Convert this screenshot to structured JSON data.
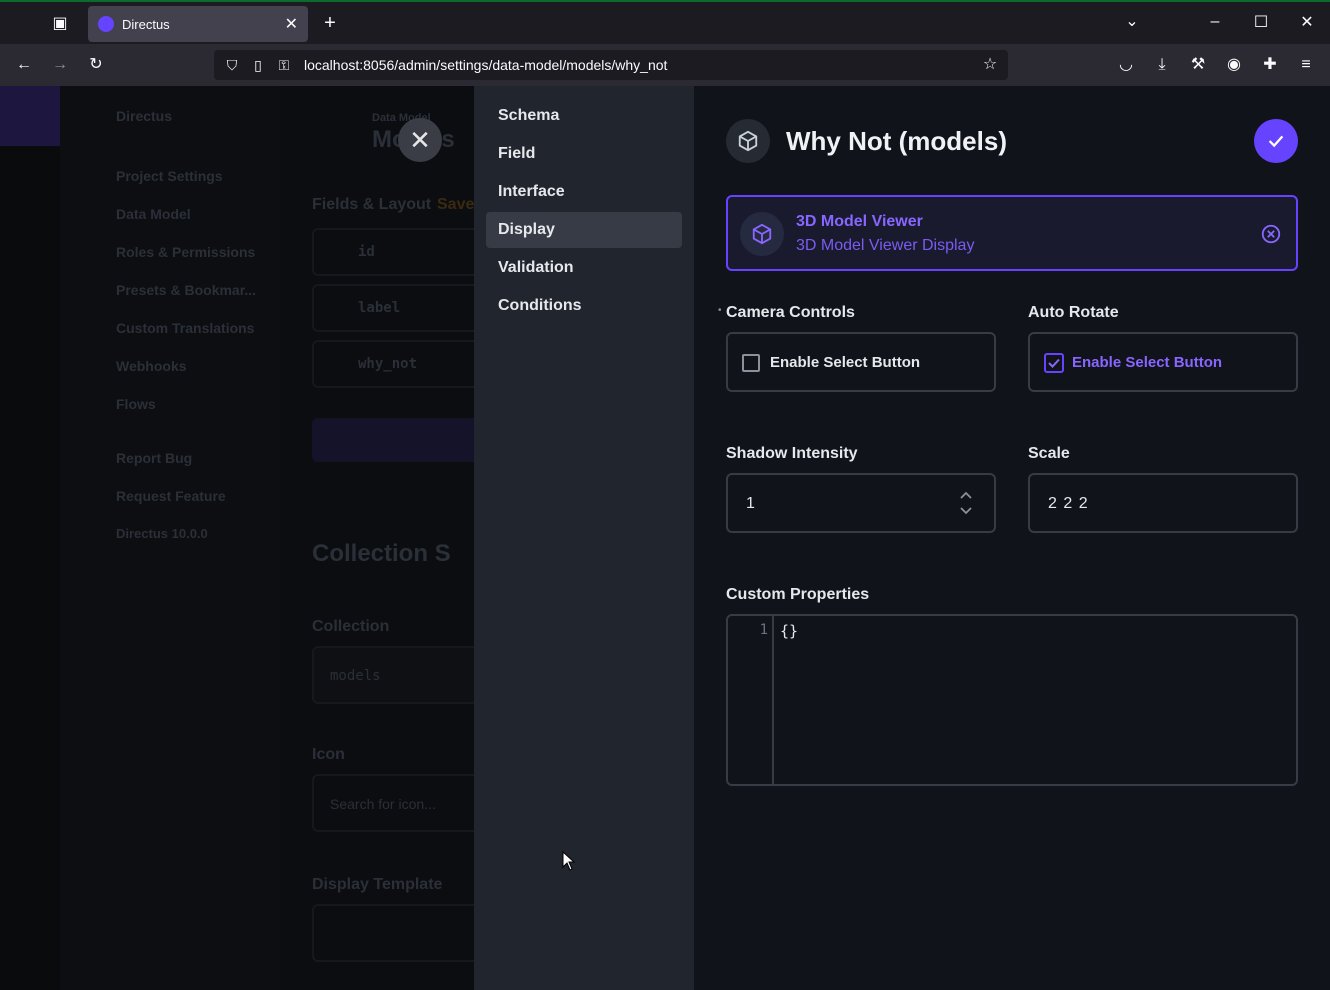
{
  "browser": {
    "tab_title": "Directus",
    "tab_close": "✕",
    "new_tab": "+",
    "url": "localhost:8056/admin/settings/data-model/models/why_not"
  },
  "background": {
    "project_name": "Directus",
    "breadcrumb": "Data Model",
    "page_title": "Models",
    "nav": [
      "Project Settings",
      "Data Model",
      "Roles & Permissions",
      "Presets & Bookmar...",
      "Custom Translations",
      "Webhooks",
      "Flows"
    ],
    "nav_secondary": [
      "Report Bug",
      "Request Feature",
      "Directus 10.0.0"
    ],
    "fields_layout": "Fields & Layout",
    "saved_label": "Save",
    "fields": [
      "id",
      "label",
      "why_not"
    ],
    "collection_setup": "Collection S",
    "collection_label": "Collection",
    "collection_value": "models",
    "icon_label": "Icon",
    "icon_placeholder": "Search for icon...",
    "display_template_label": "Display Template"
  },
  "drawer": {
    "close_icon": "✕",
    "menu": [
      "Schema",
      "Field",
      "Interface",
      "Display",
      "Validation",
      "Conditions"
    ],
    "active_menu": "Display",
    "title": "Why Not (models)",
    "selected_display": {
      "name": "3D Model Viewer",
      "description": "3D Model Viewer Display"
    },
    "camera_controls": {
      "label": "Camera Controls",
      "checkbox_label": "Enable Select Button",
      "checked": false
    },
    "auto_rotate": {
      "label": "Auto Rotate",
      "checkbox_label": "Enable Select Button",
      "checked": true
    },
    "shadow_intensity": {
      "label": "Shadow Intensity",
      "value": "1"
    },
    "scale": {
      "label": "Scale",
      "value": "2 2 2"
    },
    "custom_properties": {
      "label": "Custom Properties",
      "line_number": "1",
      "code": "{}"
    },
    "required_marker": "•"
  },
  "colors": {
    "accent": "#6644ff",
    "drawer_bg": "#10131a",
    "menu_bg": "#21252d"
  }
}
